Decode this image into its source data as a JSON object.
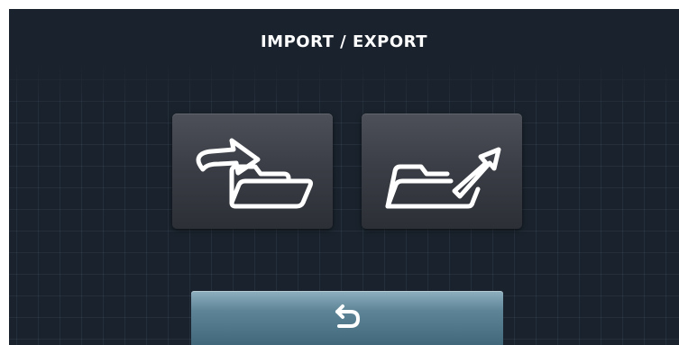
{
  "screen": {
    "title": "IMPORT / EXPORT"
  },
  "actions": [
    {
      "id": "import",
      "icon": "folder-import-icon"
    },
    {
      "id": "export",
      "icon": "folder-export-icon"
    }
  ],
  "footer": {
    "back_icon": "back-arrow-icon"
  },
  "colors": {
    "background": "#1a232d",
    "tile": "#3b3e46",
    "back_button": "#5e8597",
    "icon_stroke": "#ffffff"
  }
}
